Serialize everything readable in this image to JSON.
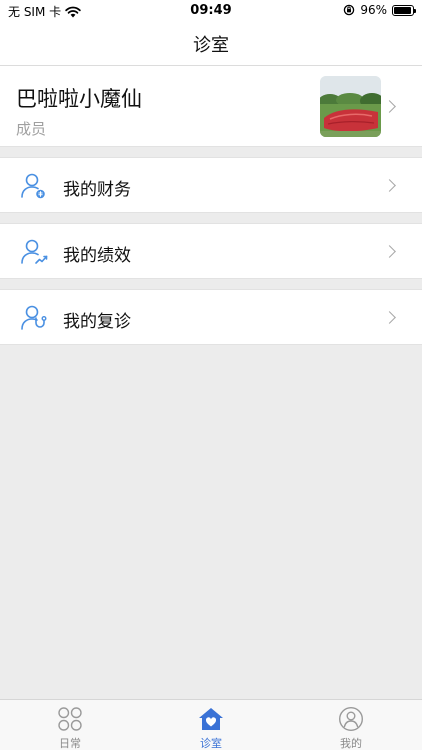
{
  "status_bar": {
    "carrier": "无 SIM 卡",
    "time": "09:49",
    "battery_percent": "96%",
    "battery_level": 0.96,
    "icons": [
      "wifi-icon",
      "orientation-lock-icon",
      "battery-icon"
    ]
  },
  "nav": {
    "title": "诊室"
  },
  "profile": {
    "name": "巴啦啦小魔仙",
    "role": "成员"
  },
  "menu": [
    {
      "label": "我的财务",
      "icon": "user-finance-icon"
    },
    {
      "label": "我的绩效",
      "icon": "user-performance-icon"
    },
    {
      "label": "我的复诊",
      "icon": "user-followup-icon"
    }
  ],
  "tabs": [
    {
      "label": "日常",
      "icon": "grid-petals-icon",
      "active": false
    },
    {
      "label": "诊室",
      "icon": "home-heart-icon",
      "active": true
    },
    {
      "label": "我的",
      "icon": "person-circle-icon",
      "active": false
    }
  ],
  "colors": {
    "accent": "#3a72d6",
    "icon_blue": "#4a90e2",
    "background": "#ececec",
    "inactive": "#8a8a8a"
  }
}
